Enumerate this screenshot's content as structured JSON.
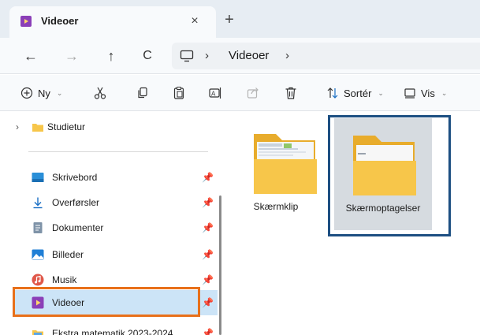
{
  "tab": {
    "title": "Videoer",
    "close": "×",
    "new_tab": "+"
  },
  "nav": {
    "back": "←",
    "forward": "→",
    "up": "↑",
    "refresh": "C",
    "separator": "›",
    "breadcrumb": "Videoer"
  },
  "commands": {
    "new_label": "Ny",
    "sort_label": "Sortér",
    "view_label": "Vis",
    "chevron": "⌄"
  },
  "sidebar": {
    "items": [
      {
        "label": "Studietur",
        "icon": "folder-icon"
      },
      {
        "label": "Skrivebord",
        "icon": "desktop-icon"
      },
      {
        "label": "Overførsler",
        "icon": "download-icon"
      },
      {
        "label": "Dokumenter",
        "icon": "document-icon"
      },
      {
        "label": "Billeder",
        "icon": "pictures-icon"
      },
      {
        "label": "Musik",
        "icon": "music-icon"
      },
      {
        "label": "Videoer",
        "icon": "video-icon",
        "selected": true
      },
      {
        "label": "Ekstra matematik 2023-2024",
        "icon": "folder-icon"
      }
    ],
    "expander": "›",
    "pin": "📌"
  },
  "content": {
    "items": [
      {
        "name": "Skærmklip",
        "icon": "folder-icon"
      },
      {
        "name": "Skærmoptagelser",
        "icon": "folder-icon",
        "selected": true
      }
    ]
  },
  "colors": {
    "highlight_orange": "#e8701a",
    "highlight_blue": "#1d4f82",
    "folder_yellow": "#f7c64a",
    "selection": "#cce4f7"
  }
}
